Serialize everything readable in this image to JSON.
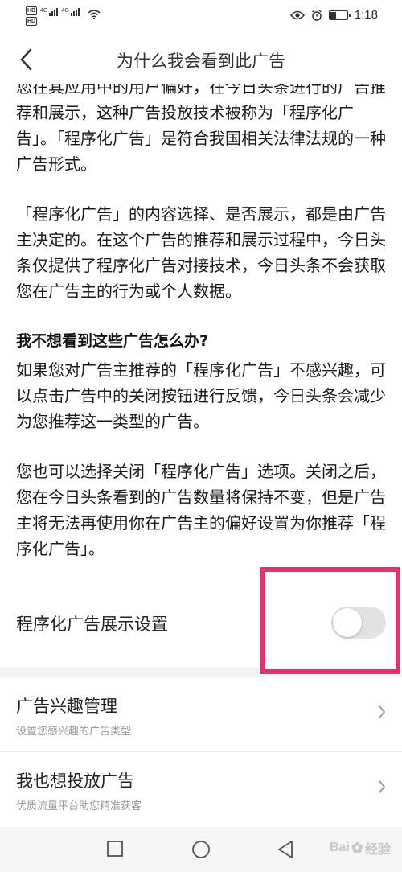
{
  "status_bar": {
    "hd1": "HD",
    "hd2": "HD",
    "net1": "4G",
    "net2": "4G",
    "icons": [
      "eye-icon",
      "alarm-icon",
      "battery-icon",
      "wifi-icon",
      "signal-icon"
    ],
    "battery_level": 0.35,
    "time": "1:18"
  },
  "header": {
    "title": "为什么我会看到此广告",
    "back_icon": "chevron-left-icon"
  },
  "article": {
    "partial_line": "您在其应用中的用户偏好，在今日头条进行的广",
    "p1_rest": "告推荐和展示，这种广告投放技术被称为「程序化广告」。「程序化广告」是符合我国相关法律法规的一种广告形式。",
    "p2": "「程序化广告」的内容选择、是否展示，都是由广告主决定的。在这个广告的推荐和展示过程中，今日头条仅提供了程序化广告对接技术，今日头条不会获取您在广告主的行为或个人数据。",
    "heading": "我不想看到这些广告怎么办?",
    "p3": "如果您对广告主推荐的「程序化广告」不感兴趣，可以点击广告中的关闭按钮进行反馈，今日头条会减少为您推荐这一类型的广告。",
    "p4": "您也可以选择关闭「程序化广告」选项。关闭之后，您在今日头条看到的广告数量将保持不变，但是广告主将无法再使用你在广告主的偏好设置为你推荐「程序化广告」。"
  },
  "setting": {
    "label": "程序化广告展示设置",
    "toggle_on": false,
    "highlight_color": "#e0336f"
  },
  "menu": [
    {
      "title": "广告兴趣管理",
      "subtitle": "设置您感兴趣的广告类型"
    },
    {
      "title": "我也想投放广告",
      "subtitle": "优质流量平台助您精准获客"
    }
  ],
  "system_nav": {
    "icons": [
      "square-icon",
      "circle-icon",
      "triangle-back-icon"
    ]
  },
  "watermark": {
    "text": "Bai",
    "text2": "经验"
  }
}
